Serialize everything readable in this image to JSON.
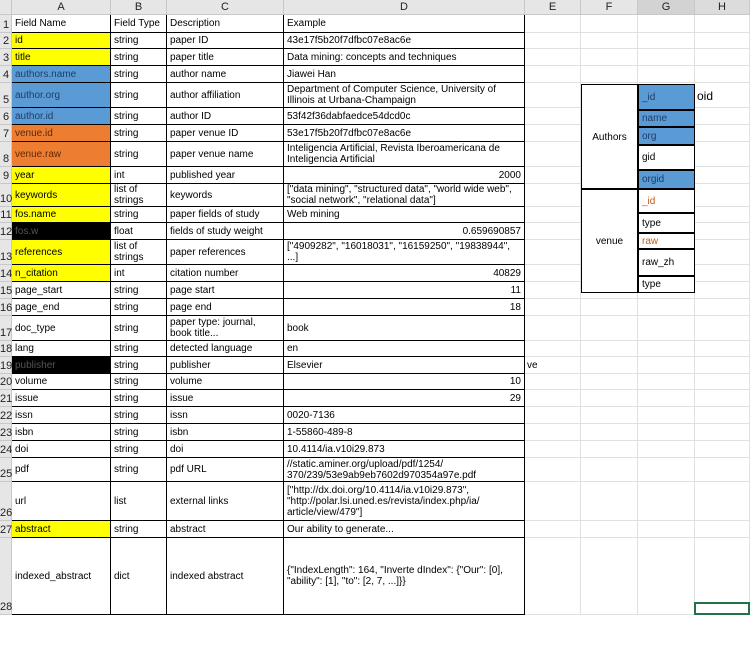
{
  "columns": [
    "A",
    "B",
    "C",
    "D",
    "E",
    "F",
    "G",
    "H"
  ],
  "rows": [
    {
      "n": "1",
      "a": "Field Name",
      "b": "Field Type",
      "c": "Description",
      "d": "Example",
      "fill": ""
    },
    {
      "n": "2",
      "a": "id",
      "b": "string",
      "c": "paper ID",
      "d": "43e17f5b20f7dfbc07e8ac6e",
      "fill": "yellow"
    },
    {
      "n": "3",
      "a": "title",
      "b": "string",
      "c": "paper title",
      "d": "Data mining: concepts and techniques",
      "fill": "yellow"
    },
    {
      "n": "4",
      "a": "authors.name",
      "b": "string",
      "c": "author name",
      "d": "Jiawei Han",
      "fill": "blue"
    },
    {
      "n": "5",
      "a": "author.org",
      "b": "string",
      "c": "author affiliation",
      "d": "Department of Computer Science, University of Illinois at Urbana-Champaign",
      "fill": "blue"
    },
    {
      "n": "6",
      "a": "author.id",
      "b": "string",
      "c": "author ID",
      "d": "53f42f36dabfaedce54dcd0c",
      "fill": "blue"
    },
    {
      "n": "7",
      "a": "venue.id",
      "b": "string",
      "c": "paper venue ID",
      "d": "53e17f5b20f7dfbc07e8ac6e",
      "fill": "orange"
    },
    {
      "n": "8",
      "a": "venue.raw",
      "b": "string",
      "c": "paper venue name",
      "d": "Inteligencia Artificial, Revista Iberoamericana de Inteligencia Artificial",
      "fill": "orange"
    },
    {
      "n": "9",
      "a": "year",
      "b": "int",
      "c": "published year",
      "d": "2000",
      "fill": "yellow",
      "num": true
    },
    {
      "n": "10",
      "a": "keywords",
      "b": "list of strings",
      "c": "keywords",
      "d": "[\"data mining\", \"structured data\", \"world wide web\", \"social network\", \"relational data\"]",
      "fill": "yellow"
    },
    {
      "n": "11",
      "a": "fos.name",
      "b": "string",
      "c": "paper fields of study",
      "d": "Web mining",
      "fill": "yellow"
    },
    {
      "n": "12",
      "a": "fos.w",
      "b": "float",
      "c": "fields of study weight",
      "d": "0.659690857",
      "fill": "black",
      "num": true
    },
    {
      "n": "13",
      "a": "references",
      "b": "list of strings",
      "c": "paper references",
      "d": "[\"4909282\", \"16018031\", \"16159250\",  \"19838944\", ...]",
      "fill": "yellow"
    },
    {
      "n": "14",
      "a": "n_citation",
      "b": "int",
      "c": "citation number",
      "d": "40829",
      "fill": "yellow",
      "num": true
    },
    {
      "n": "15",
      "a": "page_start",
      "b": "string",
      "c": "page start",
      "d": "11",
      "fill": "",
      "num": true
    },
    {
      "n": "16",
      "a": "page_end",
      "b": "string",
      "c": "page end",
      "d": "18",
      "fill": "",
      "num": true
    },
    {
      "n": "17",
      "a": "doc_type",
      "b": "string",
      "c": "paper type: journal, book title...",
      "d": "book",
      "fill": ""
    },
    {
      "n": "18",
      "a": "lang",
      "b": "string",
      "c": "detected language",
      "d": "en",
      "fill": ""
    },
    {
      "n": "19",
      "a": "publisher",
      "b": "string",
      "c": "publisher",
      "d": "Elsevier",
      "fill": "black"
    },
    {
      "n": "20",
      "a": "volume",
      "b": "string",
      "c": "volume",
      "d": "10",
      "fill": "",
      "num": true
    },
    {
      "n": "21",
      "a": "issue",
      "b": "string",
      "c": "issue",
      "d": "29",
      "fill": "",
      "num": true
    },
    {
      "n": "22",
      "a": "issn",
      "b": "string",
      "c": "issn",
      "d": "0020-7136",
      "fill": ""
    },
    {
      "n": "23",
      "a": "isbn",
      "b": "string",
      "c": "isbn",
      "d": "1-55860-489-8",
      "fill": ""
    },
    {
      "n": "24",
      "a": "doi",
      "b": "string",
      "c": "doi",
      "d": "10.4114/ia.v10i29.873",
      "fill": ""
    },
    {
      "n": "25",
      "a": "pdf",
      "b": "string",
      "c": "pdf URL",
      "d": "//static.aminer.org/upload/pdf/1254/ 370/239/53e9ab9eb7602d970354a97e.pdf",
      "fill": ""
    },
    {
      "n": "26",
      "a": "url",
      "b": "list",
      "c": "external links",
      "d": "[\"http://dx.doi.org/10.4114/ia.v10i29.873\", \"http://polar.lsi.uned.es/revista/index.php/ia/ article/view/479\"]",
      "fill": ""
    },
    {
      "n": "27",
      "a": "abstract",
      "b": "string",
      "c": "abstract",
      "d": "Our ability to generate...",
      "fill": "yellow"
    },
    {
      "n": "28",
      "a": "indexed_abstract",
      "b": "dict",
      "c": "indexed abstract",
      "d": "{\"IndexLength\": 164, \"Inverte dIndex\": {\"Our\": [0], \"ability\": [1], \"to\": [2, 7, ...]}}",
      "fill": ""
    }
  ],
  "stray": {
    "e19": "ve",
    "h5": "oid"
  },
  "authors_box": {
    "label": "Authors",
    "items": [
      {
        "text": "_id",
        "style": "blue"
      },
      {
        "text": "name",
        "style": "blue"
      },
      {
        "text": "org",
        "style": "blue"
      },
      {
        "text": "gid",
        "style": "plain"
      },
      {
        "text": "orgid",
        "style": "blue"
      }
    ]
  },
  "venue_box": {
    "label": "venue",
    "items": [
      {
        "text": "_id",
        "style": "red"
      },
      {
        "text": "type",
        "style": "plain"
      },
      {
        "text": "raw",
        "style": "red"
      },
      {
        "text": "raw_zh",
        "style": "plain"
      },
      {
        "text": "type",
        "style": "plain"
      }
    ]
  },
  "colors": {
    "yellow": "#ffff00",
    "blue": "#5b9bd5",
    "orange": "#ed7d31",
    "black": "#000000",
    "red_text": "#c55a11",
    "selection": "#217346"
  }
}
